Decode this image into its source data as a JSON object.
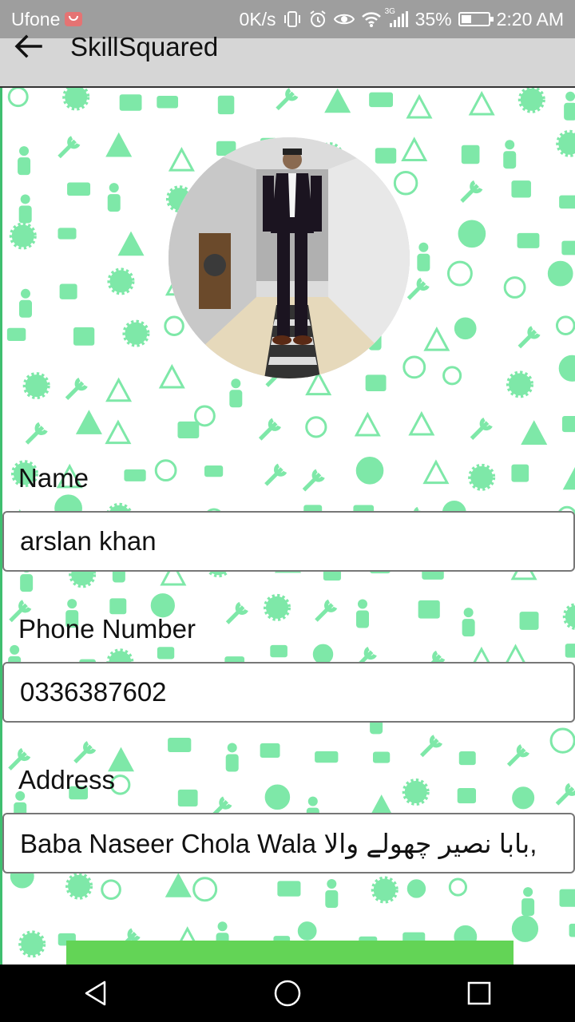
{
  "status_bar": {
    "carrier": "Ufone",
    "net_speed": "0K/s",
    "signal_label": "3G",
    "battery": "35%",
    "battery_level": 0.35,
    "time": "2:20 AM"
  },
  "app_bar": {
    "title": "SkillSquared"
  },
  "profile": {
    "name_label": "Name",
    "name_value": "arslan khan",
    "phone_label": "Phone Number",
    "phone_value": "0336387602",
    "address_label": "Address",
    "address_value": "Baba Naseer Chola Wala بابا نصیر چھولے والا,"
  },
  "colors": {
    "status_bar": "#9e9e9e",
    "app_bar": "#d6d6d6",
    "pattern": "#7ee8a8",
    "accent_border": "#3fbf6f",
    "submit_button": "#63d456"
  },
  "icons": [
    "back-arrow-icon",
    "vibrate-icon",
    "alarm-icon",
    "eye-icon",
    "wifi-icon",
    "signal-icon",
    "battery-icon",
    "nav-back-icon",
    "nav-home-icon",
    "nav-recents-icon"
  ]
}
